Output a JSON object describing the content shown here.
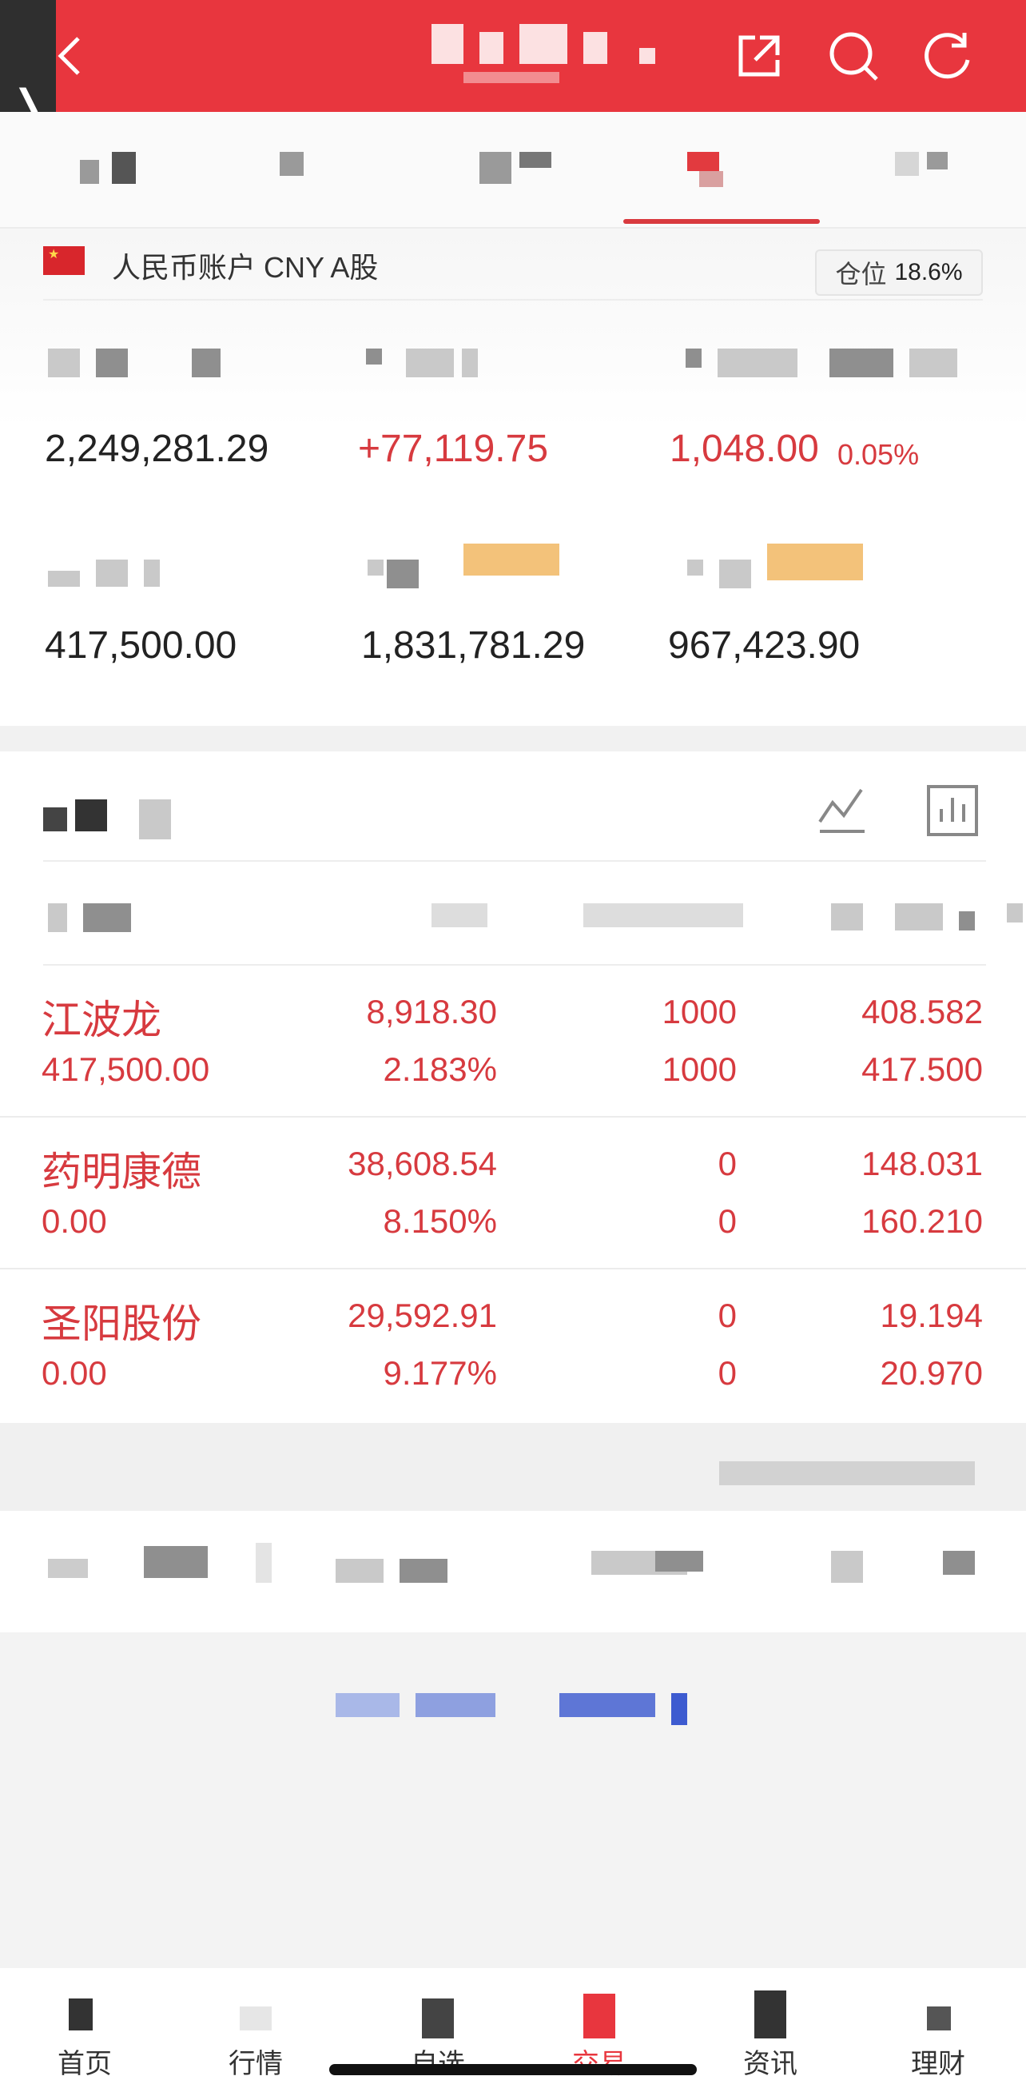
{
  "account": {
    "flag_icon": "china-flag-icon",
    "name": "人民币账户 CNY A股",
    "position_label": "仓位",
    "position_value": "18.6%"
  },
  "stats": {
    "row1": [
      "2,249,281.29",
      "+77,119.75",
      "1,048.00"
    ],
    "row1_pct": "0.05%",
    "row2": [
      "417,500.00",
      "1,831,781.29",
      "967,423.90"
    ]
  },
  "holdings": [
    {
      "name": "江波龙",
      "sub": "417,500.00",
      "c2a": "8,918.30",
      "c2b": "2.183%",
      "c3a": "1000",
      "c3b": "1000",
      "c4a": "408.582",
      "c4b": "417.500"
    },
    {
      "name": "药明康德",
      "sub": "0.00",
      "c2a": "38,608.54",
      "c2b": "8.150%",
      "c3a": "0",
      "c3b": "0",
      "c4a": "148.031",
      "c4b": "160.210"
    },
    {
      "name": "圣阳股份",
      "sub": "0.00",
      "c2a": "29,592.91",
      "c2b": "9.177%",
      "c3a": "0",
      "c3b": "0",
      "c4a": "19.194",
      "c4b": "20.970"
    }
  ],
  "nav": [
    {
      "label": "首页",
      "icon": "home-icon"
    },
    {
      "label": "行情",
      "icon": "market-icon"
    },
    {
      "label": "自选",
      "icon": "watchlist-icon"
    },
    {
      "label": "交易",
      "icon": "trade-icon"
    },
    {
      "label": "资讯",
      "icon": "news-icon"
    },
    {
      "label": "理财",
      "icon": "wealth-icon"
    }
  ],
  "colors": {
    "brand_red": "#e8363e",
    "stock_red": "#d73a3f"
  }
}
